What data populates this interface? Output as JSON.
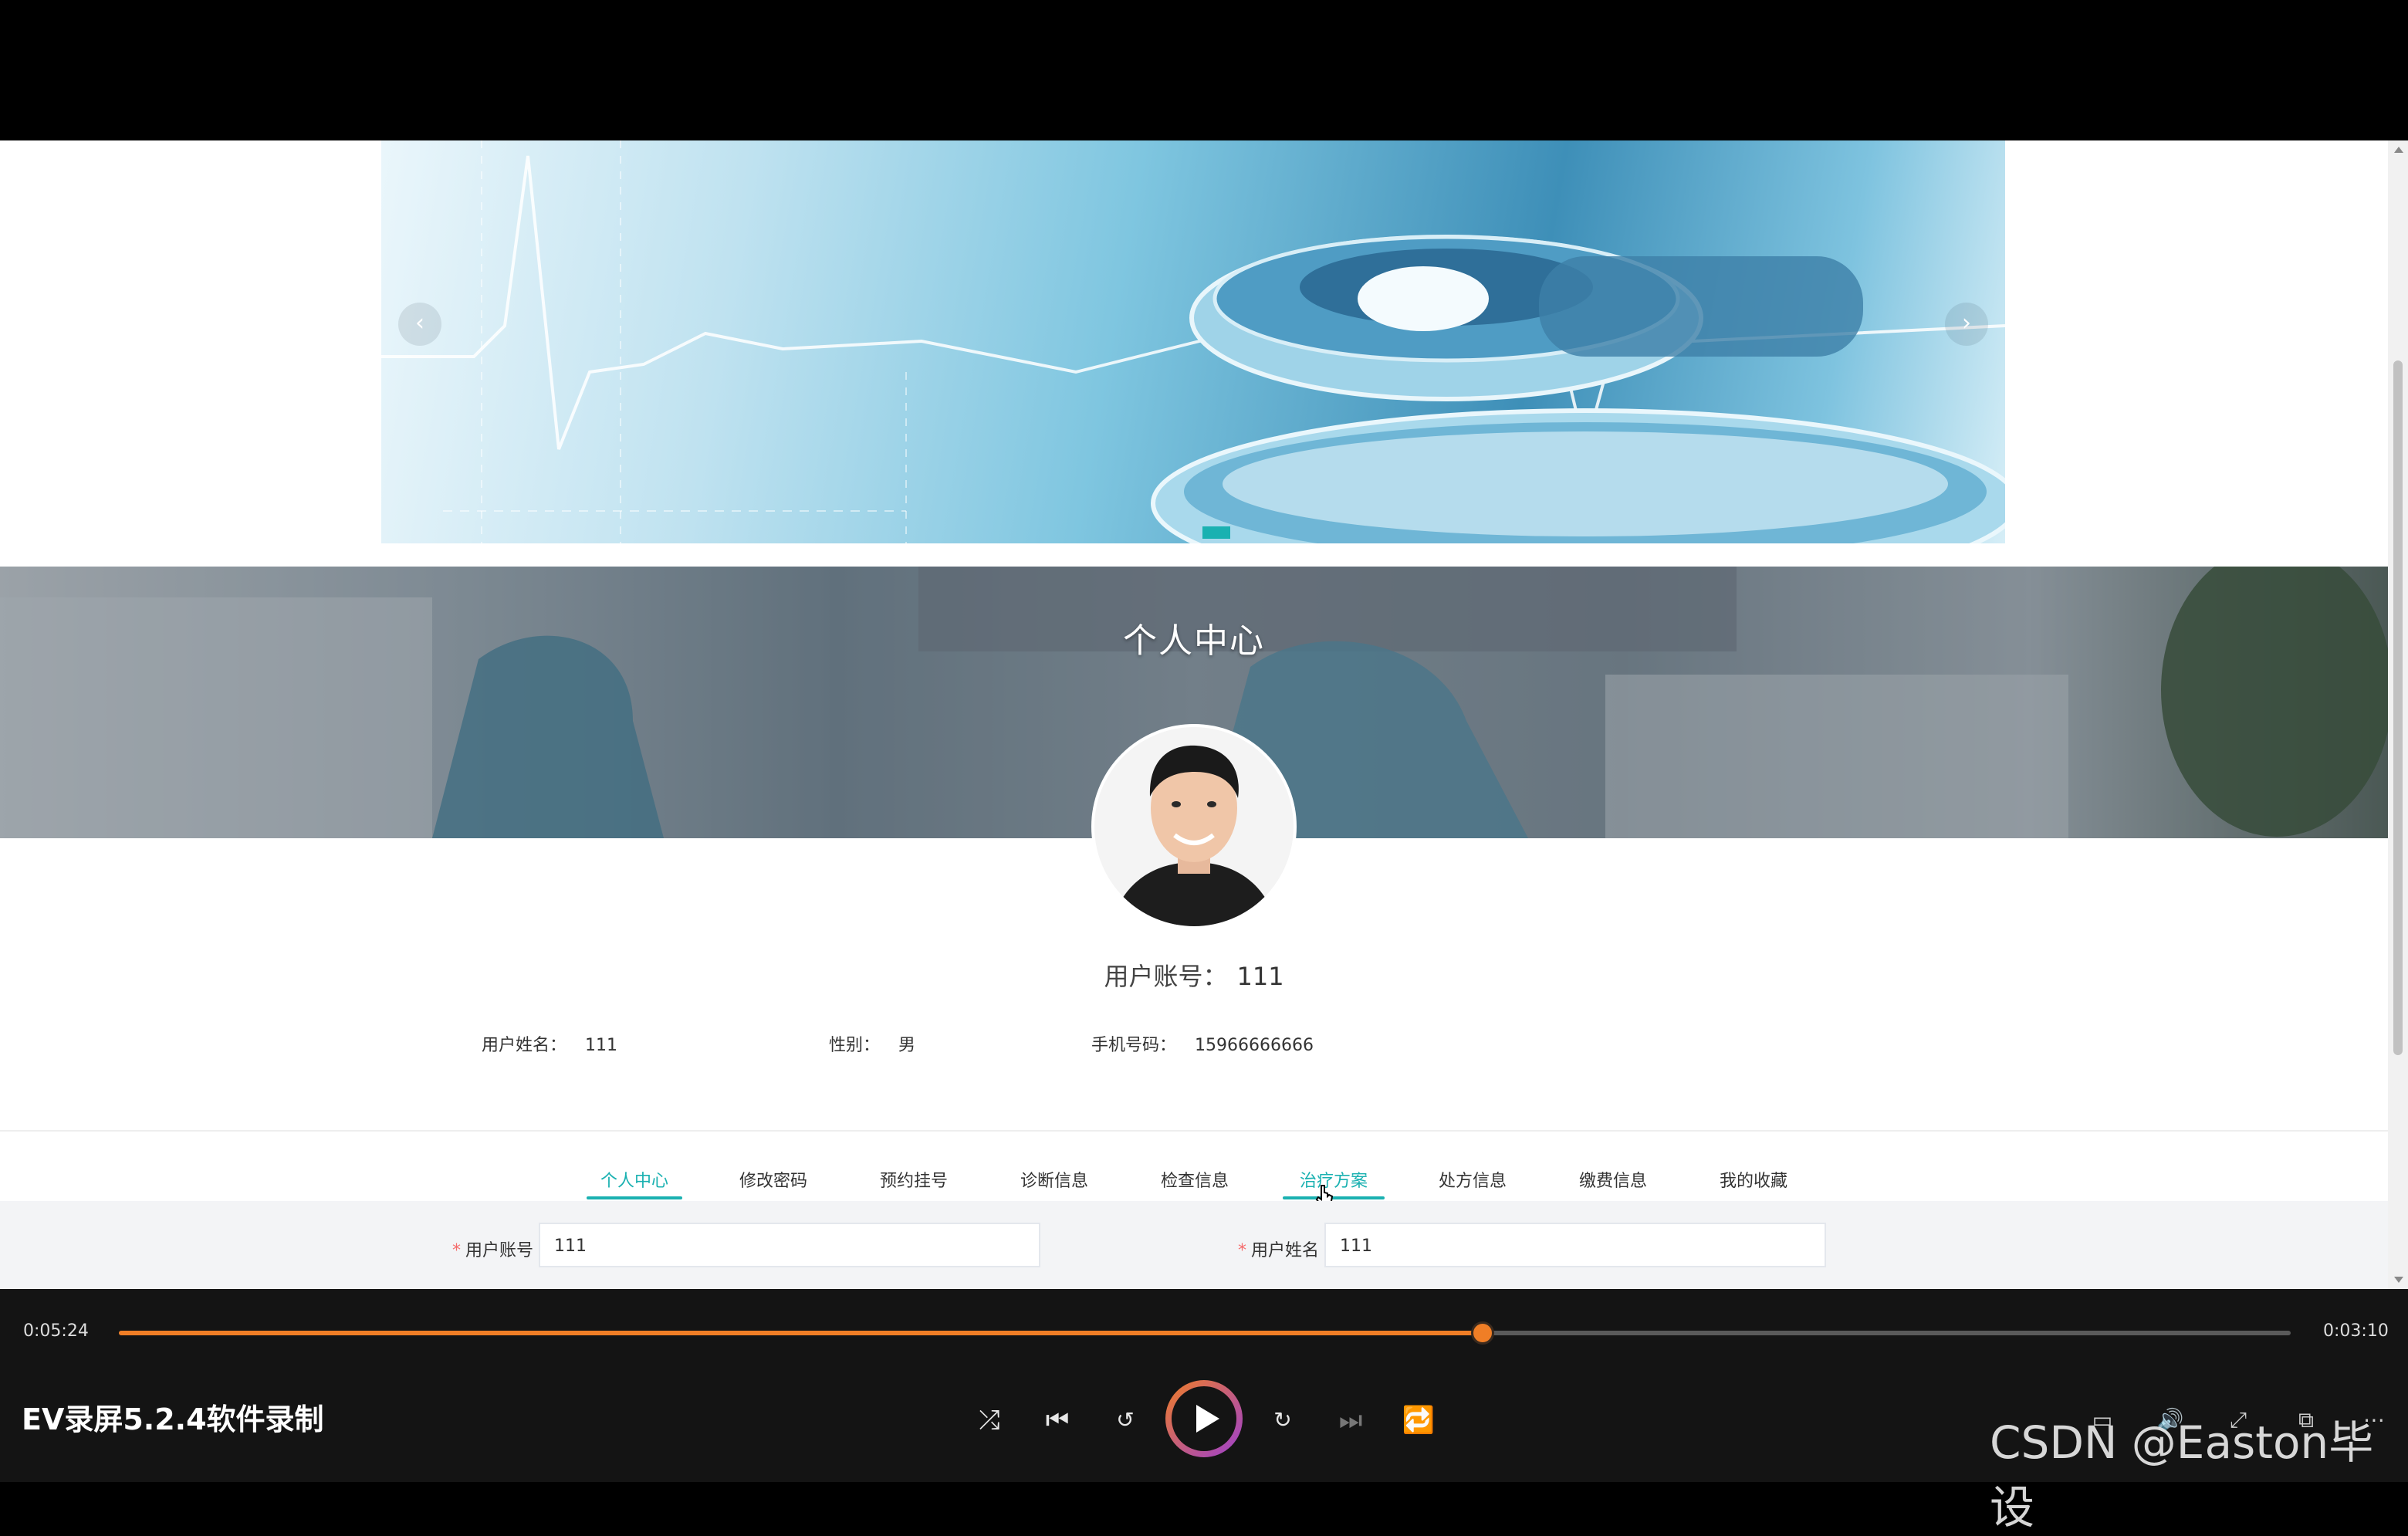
{
  "page": {
    "hero_title": "个人中心",
    "account_label": "用户账号：",
    "account_value": "111",
    "info": [
      {
        "label": "用户姓名：",
        "value": "111"
      },
      {
        "label": "性别：",
        "value": "男"
      },
      {
        "label": "手机号码：",
        "value": "15966666666"
      }
    ],
    "tabs": [
      {
        "label": "个人中心",
        "state": "active"
      },
      {
        "label": "修改密码"
      },
      {
        "label": "预约挂号"
      },
      {
        "label": "诊断信息"
      },
      {
        "label": "检查信息"
      },
      {
        "label": "治疗方案",
        "state": "hover"
      },
      {
        "label": "处方信息"
      },
      {
        "label": "缴费信息"
      },
      {
        "label": "我的收藏"
      }
    ],
    "form": {
      "account_label": "用户账号",
      "account_value": "111",
      "name_label": "用户姓名",
      "name_value": "111",
      "required_mark": "*"
    }
  },
  "player": {
    "current_time": "0:05:24",
    "total_time": "0:03:10",
    "progress_fraction": 0.628,
    "app_title": "EV录屏5.2.4软件录制",
    "watermark": "CSDN @Easton毕设"
  },
  "colors": {
    "accent": "#1ab1b1",
    "player_accent": "#f07e26",
    "required": "#f56c6c"
  },
  "icons": [
    "carousel-prev-icon",
    "carousel-next-icon",
    "shuffle-icon",
    "skip-previous-icon",
    "rewind-10-icon",
    "play-icon",
    "forward-30-icon",
    "skip-next-icon",
    "repeat-off-icon",
    "subtitles-icon",
    "volume-icon",
    "fullscreen-icon",
    "mini-player-icon",
    "more-icon",
    "mouse-cursor-icon"
  ]
}
